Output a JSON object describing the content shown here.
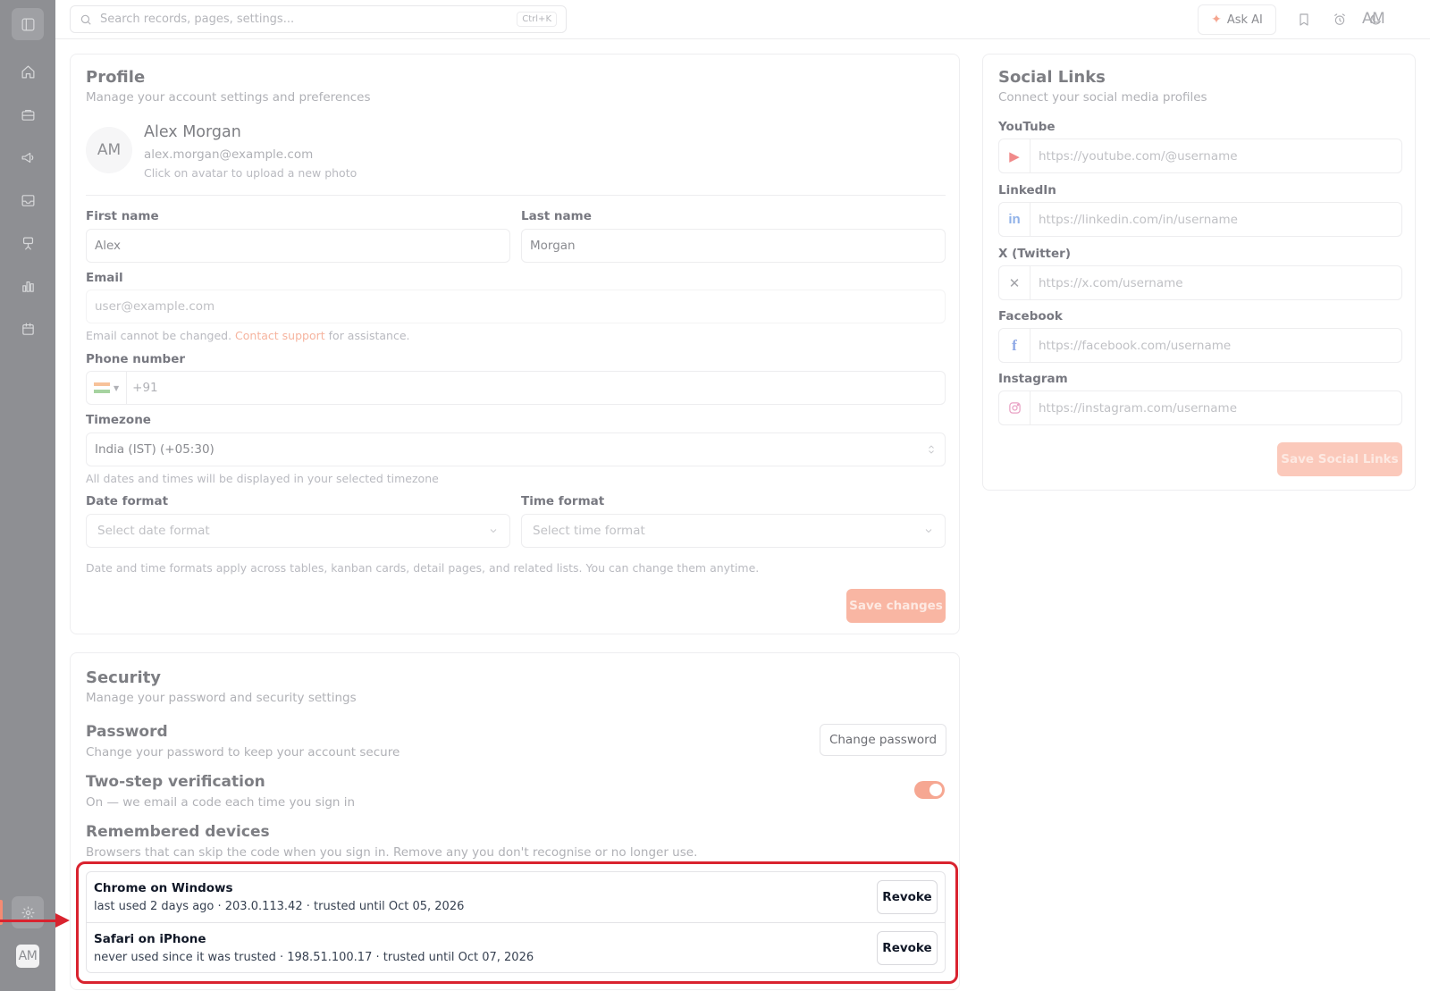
{
  "search": {
    "placeholder": "Search records, pages, settings...",
    "shortcut": "Ctrl+K"
  },
  "topbar": {
    "ask_ai": "Ask AI",
    "avatar": "AM"
  },
  "rail": {
    "avatar": "AM"
  },
  "profile": {
    "title": "Profile",
    "subtitle": "Manage your account settings and preferences",
    "avatar_initials": "AM",
    "name": "Alex Morgan",
    "email": "alex.morgan@example.com",
    "avatar_hint": "Click on avatar to upload a new photo",
    "first_name_label": "First name",
    "first_name_value": "Alex",
    "last_name_label": "Last name",
    "last_name_value": "Morgan",
    "email_label": "Email",
    "email_placeholder": "user@example.com",
    "email_hint_prefix": "Email cannot be changed.",
    "email_hint_link": "Contact support",
    "email_hint_suffix": "for assistance.",
    "phone_label": "Phone number",
    "phone_prefix": "+91",
    "timezone_label": "Timezone",
    "timezone_value": "India (IST) (+05:30)",
    "timezone_hint": "All dates and times will be displayed in your selected timezone",
    "date_format_label": "Date format",
    "date_format_placeholder": "Select date format",
    "time_format_label": "Time format",
    "time_format_placeholder": "Select time format",
    "format_hint": "Date and time formats apply across tables, kanban cards, detail pages, and related lists. You can change them anytime.",
    "save_label": "Save changes"
  },
  "security": {
    "title": "Security",
    "subtitle": "Manage your password and security settings",
    "password_title": "Password",
    "password_sub": "Change your password to keep your account secure",
    "change_password_label": "Change password",
    "two_step_title": "Two-step verification",
    "two_step_sub": "On — we email a code each time you sign in",
    "two_step_enabled": true,
    "remembered_title": "Remembered devices",
    "remembered_sub": "Browsers that can skip the code when you sign in. Remove any you don't recognise or no longer use.",
    "devices": [
      {
        "name": "Chrome on Windows",
        "meta": "last used 2 days ago · 203.0.113.42 · trusted until Oct 05, 2026",
        "action": "Revoke"
      },
      {
        "name": "Safari on iPhone",
        "meta": "never used since it was trusted · 198.51.100.17 · trusted until Oct 07, 2026",
        "action": "Revoke"
      }
    ]
  },
  "social": {
    "title": "Social Links",
    "subtitle": "Connect your social media profiles",
    "links": [
      {
        "label": "YouTube",
        "icon": "youtube-icon",
        "placeholder": "https://youtube.com/@username"
      },
      {
        "label": "LinkedIn",
        "icon": "linkedin-icon",
        "placeholder": "https://linkedin.com/in/username"
      },
      {
        "label": "X (Twitter)",
        "icon": "x-icon",
        "placeholder": "https://x.com/username"
      },
      {
        "label": "Facebook",
        "icon": "facebook-icon",
        "placeholder": "https://facebook.com/username"
      },
      {
        "label": "Instagram",
        "icon": "instagram-icon",
        "placeholder": "https://instagram.com/username"
      }
    ],
    "save_label": "Save Social Links"
  },
  "colors": {
    "accent": "#f9b6a3",
    "highlight": "#d9232f",
    "rail": "#8e8f93"
  }
}
